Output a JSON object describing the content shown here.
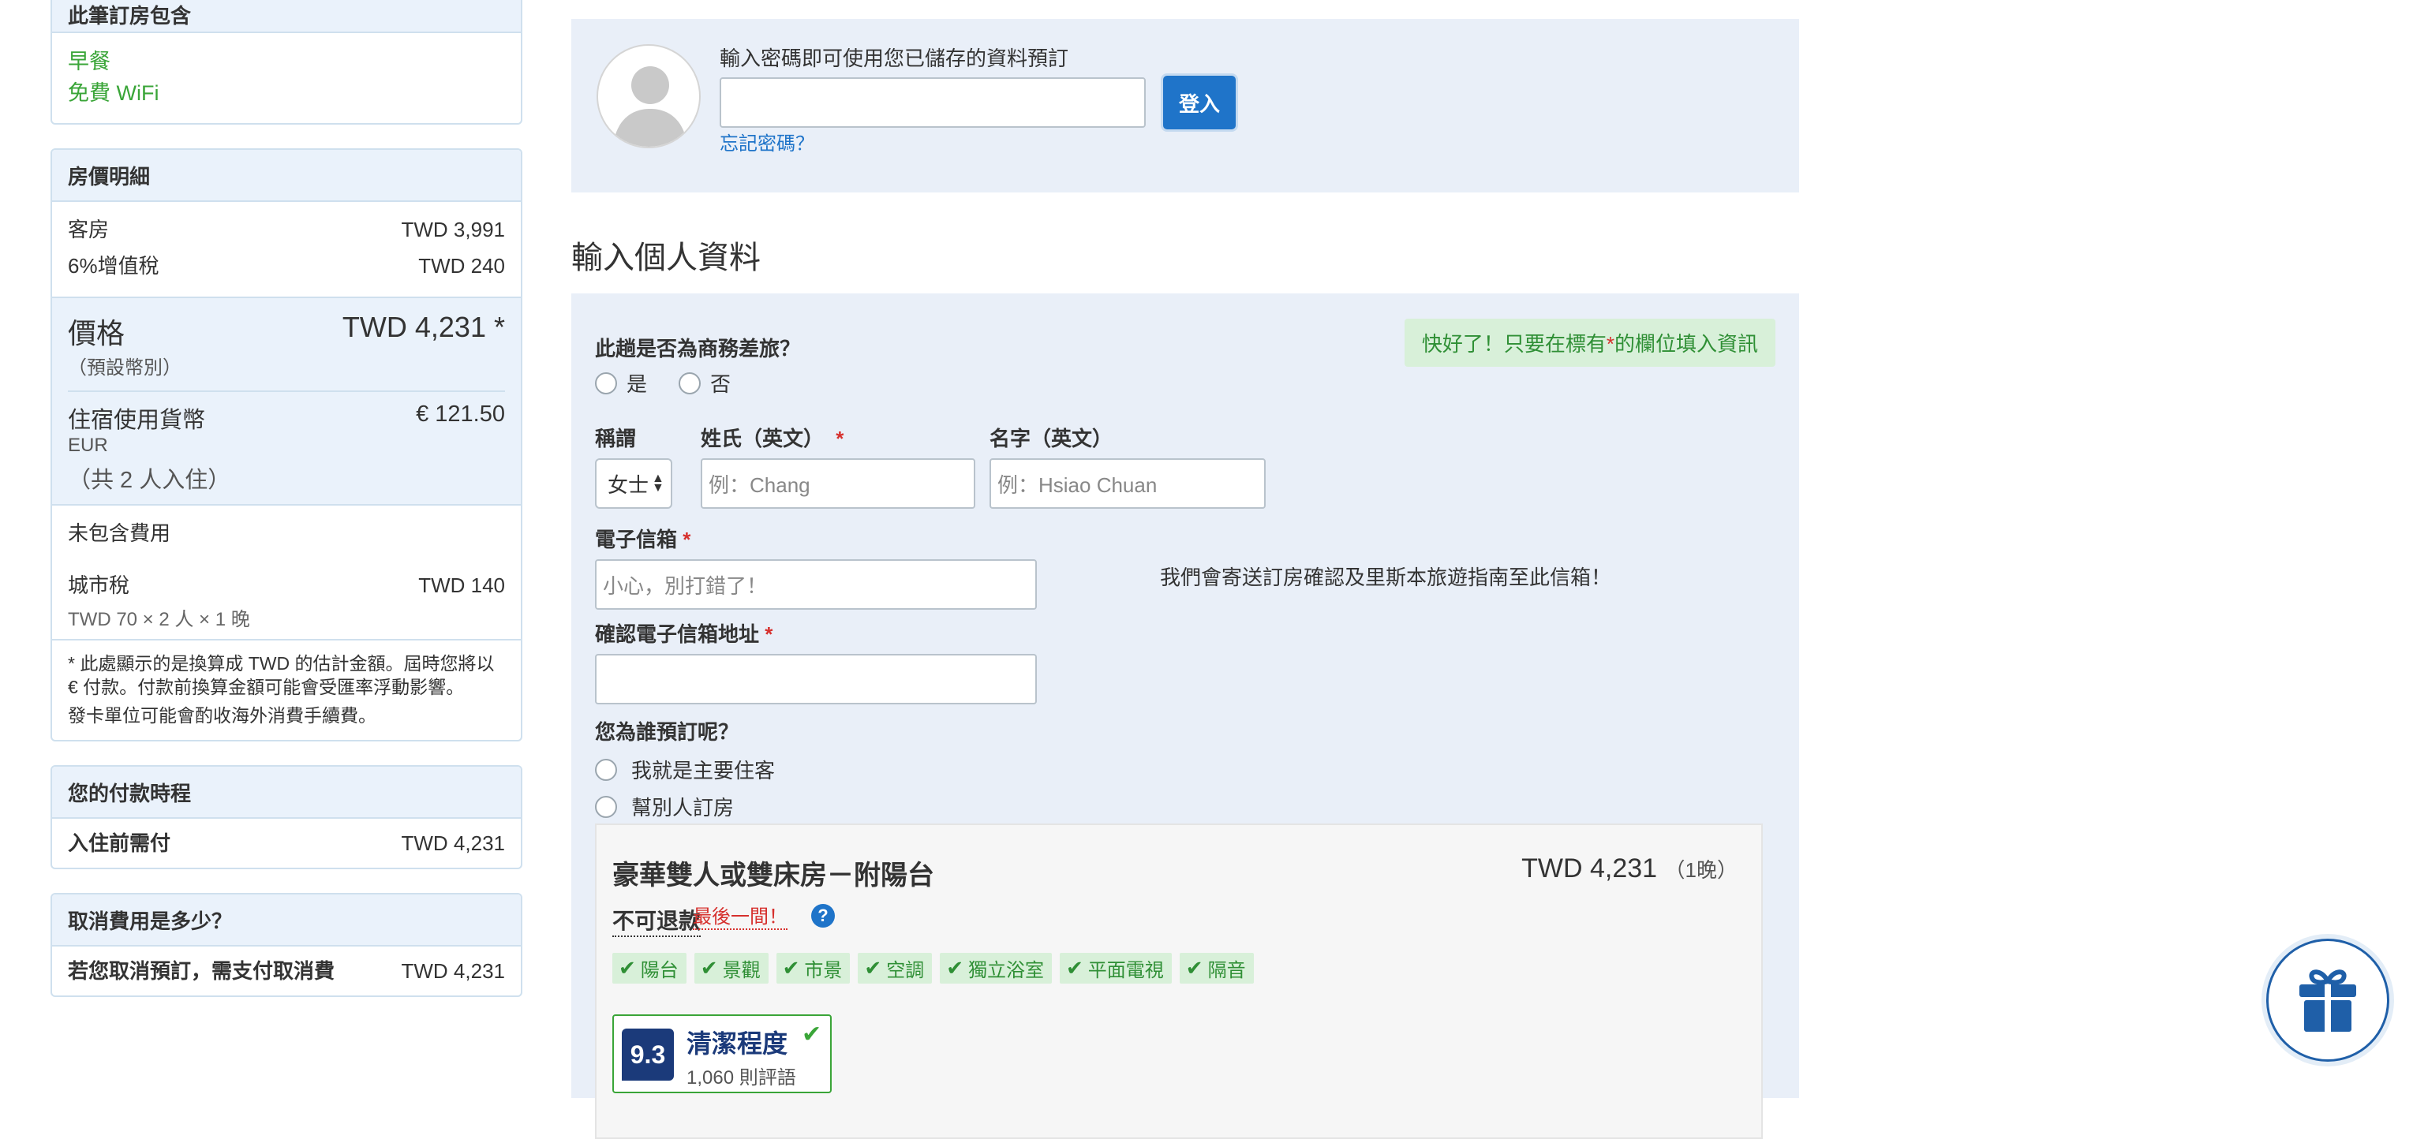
{
  "sidebar": {
    "includes": {
      "title": "此筆訂房包含",
      "items": [
        "早餐",
        "免費 WiFi"
      ]
    },
    "price_detail": {
      "title": "房價明細",
      "lines": [
        {
          "label": "客房",
          "value": "TWD 3,991"
        },
        {
          "label": "6%增值稅",
          "value": "TWD 240"
        }
      ],
      "total_label": "價格",
      "total_value": "TWD 4,231 *",
      "total_sub": "（預設幣別）",
      "local_label": "住宿使用貨幣",
      "local_value": "€ 121.50",
      "local_currency": "EUR",
      "guests_note": "（共 2 人入住）",
      "excluded_title": "未包含費用",
      "city_tax_label": "城市稅",
      "city_tax_value": "TWD 140",
      "city_tax_calc": "TWD 70 × 2 人 × 1 晚",
      "note1": "* 此處顯示的是換算成 TWD 的估計金額。屆時您將以 € 付款。付款前換算金額可能會受匯率浮動影響。",
      "note2": "發卡單位可能會酌收海外消費手續費。"
    },
    "payment": {
      "title": "您的付款時程",
      "label": "入住前需付",
      "value": "TWD 4,231"
    },
    "cancel": {
      "title": "取消費用是多少？",
      "label": "若您取消預訂，需支付取消費",
      "value": "TWD 4,231"
    }
  },
  "login": {
    "label": "輸入密碼即可使用您已儲存的資料預訂",
    "button": "登入",
    "forgot": "忘記密碼？"
  },
  "form": {
    "section_title": "輸入個人資料",
    "hint_prefix": "快好了！只要在標有",
    "hint_star": "*",
    "hint_suffix": "的欄位填入資訊",
    "business_q": "此趟是否為商務差旅？",
    "yes": "是",
    "no": "否",
    "title_label": "稱謂",
    "title_value": "女士",
    "lastname_label": "姓氏（英文）",
    "lastname_placeholder": "例：Chang",
    "firstname_label": "名字（英文）",
    "firstname_placeholder": "例：Hsiao Chuan",
    "email_label": "電子信箱",
    "email_placeholder": "小心，別打錯了！",
    "email_note": "我們會寄送訂房確認及里斯本旅遊指南至此信箱！",
    "confirm_email_label": "確認電子信箱地址",
    "for_whom_q": "您為誰預訂呢？",
    "option_self": "我就是主要住客",
    "option_other": "幫別人訂房",
    "required_star": "*"
  },
  "room": {
    "title": "豪華雙人或雙床房－附陽台",
    "price": "TWD 4,231",
    "nights": "（1晚）",
    "nonrefundable": "不可退款",
    "last_room": "最後一間！",
    "help": "?",
    "amenities": [
      "陽台",
      "景觀",
      "市景",
      "空調",
      "獨立浴室",
      "平面電視",
      "隔音"
    ],
    "score": "9.3",
    "score_label": "清潔程度",
    "reviews": "1,060 則評語"
  },
  "colors": {
    "accent": "#1f74c9",
    "green": "#3aa538",
    "panel_bg": "#e9eff8",
    "required": "#d6302d"
  }
}
